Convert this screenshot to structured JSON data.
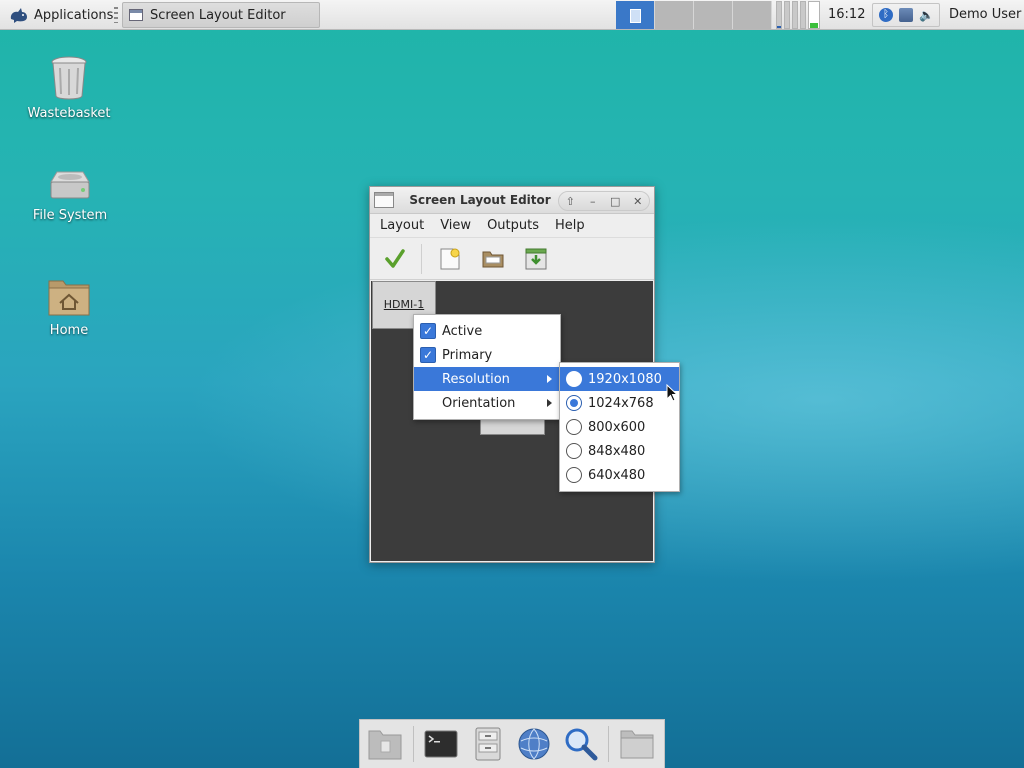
{
  "top_panel": {
    "applications_label": "Applications",
    "task_title": "Screen Layout Editor",
    "clock": "16:12",
    "user": "Demo User"
  },
  "desktop": {
    "icons": [
      {
        "label": "Wastebasket",
        "icon": "trash-icon"
      },
      {
        "label": "File System",
        "icon": "drive-icon"
      },
      {
        "label": "Home",
        "icon": "home-folder-icon"
      }
    ]
  },
  "window": {
    "title": "Screen Layout Editor",
    "menu": [
      "Layout",
      "View",
      "Outputs",
      "Help"
    ],
    "toolbar": [
      "apply-icon",
      "new-layout-icon",
      "open-layout-icon",
      "save-layout-icon"
    ],
    "output_label": "HDMI-1"
  },
  "context_menu": {
    "items": [
      {
        "label": "Active",
        "checked": true
      },
      {
        "label": "Primary",
        "checked": true
      },
      {
        "label": "Resolution",
        "submenu": true,
        "highlighted": true
      },
      {
        "label": "Orientation",
        "submenu": true
      }
    ]
  },
  "resolution_menu": {
    "items": [
      {
        "label": "1920x1080",
        "selected": false,
        "highlighted": true
      },
      {
        "label": "1024x768",
        "selected": true
      },
      {
        "label": "800x600",
        "selected": false
      },
      {
        "label": "848x480",
        "selected": false
      },
      {
        "label": "640x480",
        "selected": false
      }
    ]
  },
  "dock": {
    "items": [
      "show-desktop-icon",
      "terminal-icon",
      "file-manager-icon",
      "web-browser-icon",
      "search-icon",
      "folder-icon"
    ]
  },
  "colors": {
    "highlight": "#3a78d9",
    "canvas": "#3c3c3c"
  }
}
